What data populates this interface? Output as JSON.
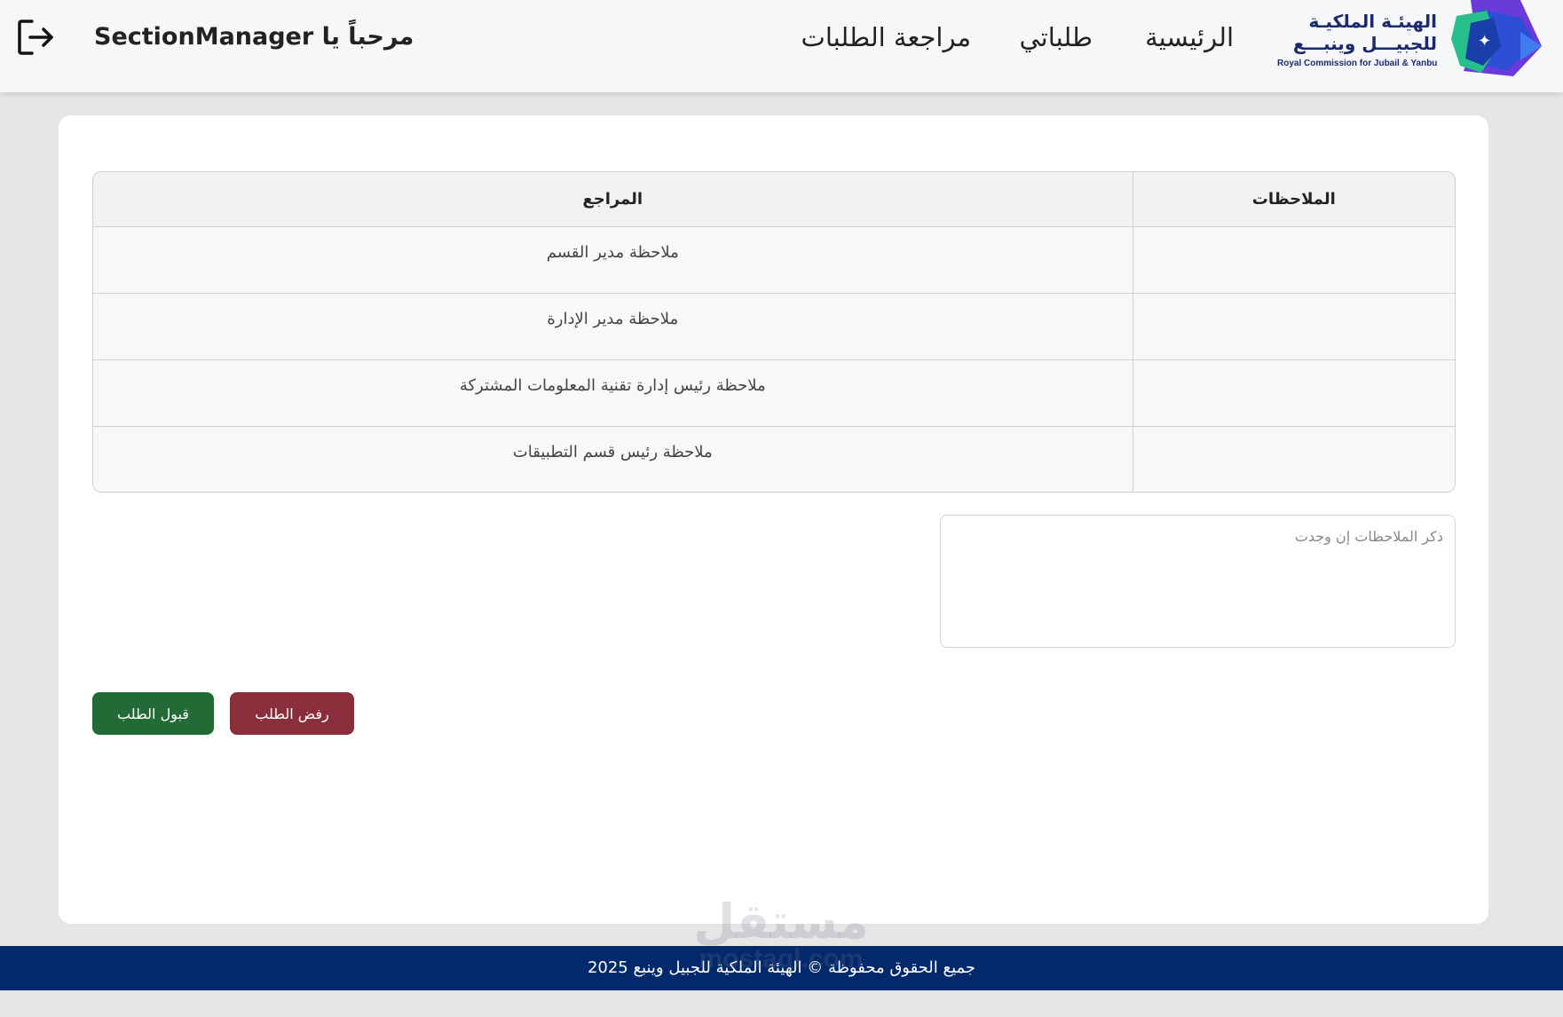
{
  "header": {
    "logo": {
      "name_ar_line1": "الهيئـة الملكيـة",
      "name_ar_line2": "للجبيـــل وينبـــع",
      "name_en": "Royal Commission for Jubail & Yanbu",
      "icon": "rcjy-logo-mark"
    },
    "nav": {
      "home": "الرئيسية",
      "my_requests": "طلباتي",
      "review_requests": "مراجعة الطلبات"
    },
    "welcome": "مرحباً يا SectionManager",
    "logout_icon": "logout-icon"
  },
  "table": {
    "headers": {
      "notes": "الملاحظات",
      "reviewer": "المراجع"
    },
    "rows": [
      {
        "notes": "",
        "reviewer": "ملاحظة مدير القسم"
      },
      {
        "notes": "",
        "reviewer": "ملاحظة مدير الإدارة"
      },
      {
        "notes": "",
        "reviewer": "ملاحظة رئيس إدارة تقنية المعلومات المشتركة"
      },
      {
        "notes": "",
        "reviewer": "ملاحظة رئيس قسم التطبيقات"
      }
    ]
  },
  "notes_input": {
    "value": "",
    "placeholder": "ذكر الملاحظات إن وجدت"
  },
  "actions": {
    "reject": "رفض الطلب",
    "accept": "قبول الطلب"
  },
  "footer": {
    "copyright": "جميع الحقوق محفوظة © الهيئة الملكية للجبيل وينبع 2025"
  },
  "watermark": {
    "ar": "مستقل",
    "en": "mostaql.com"
  },
  "colors": {
    "accept": "#226b36",
    "reject": "#8b2e3b",
    "footer": "#02296b",
    "brand_text": "#1b2a6b"
  }
}
